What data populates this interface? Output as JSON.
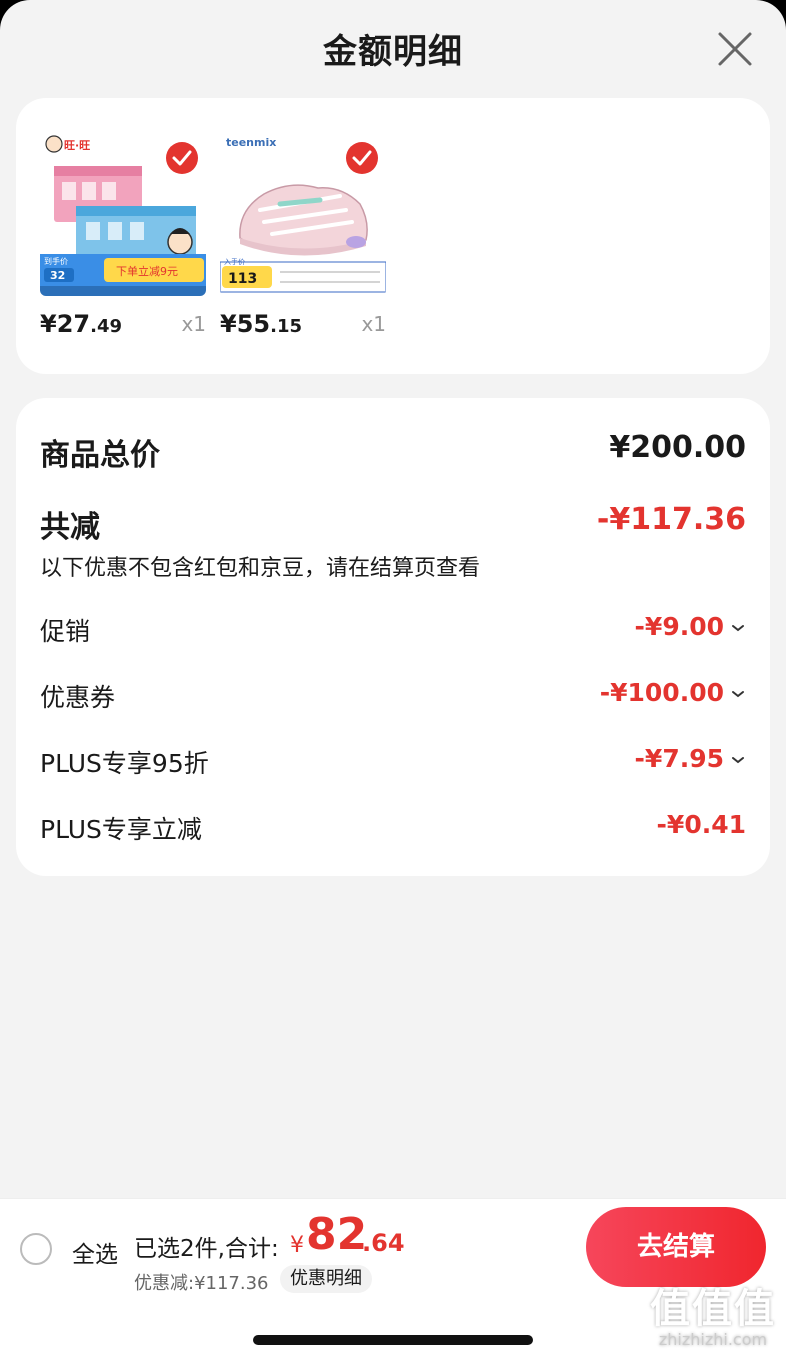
{
  "header": {
    "title": "金额明细",
    "close_icon": "close-icon"
  },
  "products": [
    {
      "brand": "旺·旺",
      "banner_top": "到手价",
      "banner_price": "32",
      "banner_promo": "下单立减9元",
      "price_int": "¥27",
      "price_dec": ".49",
      "qty": "x1",
      "checked": true
    },
    {
      "brand": "teenmix",
      "banner_top": "入手价",
      "banner_price": "113",
      "price_int": "¥55",
      "price_dec": ".15",
      "qty": "x1",
      "checked": true
    }
  ],
  "summary": {
    "total_label": "商品总价",
    "total_value": "¥200.00",
    "reduce_label": "共减",
    "reduce_value": "-¥117.36",
    "note": "以下优惠不包含红包和京豆，请在结算页查看",
    "items": [
      {
        "label": "促销",
        "value": "-¥9.00",
        "expandable": true
      },
      {
        "label": "优惠券",
        "value": "-¥100.00",
        "expandable": true
      },
      {
        "label": "PLUS专享95折",
        "value": "-¥7.95",
        "expandable": true
      },
      {
        "label": "PLUS专享立减",
        "value": "-¥0.41",
        "expandable": false
      }
    ]
  },
  "footer": {
    "select_all": "全选",
    "selected_count": "已选2件,合计:",
    "total_symbol": "¥",
    "total_int": "82",
    "total_dec": ".64",
    "discount": "优惠减:¥117.36",
    "detail_pill": "优惠明细",
    "checkout": "去结算"
  },
  "watermark": {
    "main": "值值值",
    "sub": "zhizhizhi.com"
  },
  "colors": {
    "accent_red": "#e3342f",
    "checkout_gradient_start": "#f6465b",
    "checkout_gradient_end": "#f0262e"
  }
}
